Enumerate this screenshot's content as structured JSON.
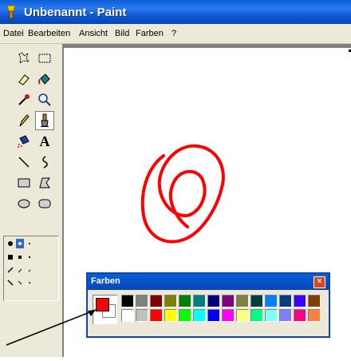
{
  "window": {
    "title": "Unbenannt - Paint"
  },
  "menu": [
    "Datei",
    "Bearbeiten",
    "Ansicht",
    "Bild",
    "Farben",
    "?"
  ],
  "tools": [
    {
      "name": "free-select-icon"
    },
    {
      "name": "rect-select-icon"
    },
    {
      "name": "eraser-icon"
    },
    {
      "name": "fill-bucket-icon"
    },
    {
      "name": "color-picker-icon"
    },
    {
      "name": "magnifier-icon"
    },
    {
      "name": "pencil-icon"
    },
    {
      "name": "brush-icon",
      "selected": true
    },
    {
      "name": "airbrush-icon"
    },
    {
      "name": "text-icon",
      "glyph": "A"
    },
    {
      "name": "line-icon"
    },
    {
      "name": "curve-icon"
    },
    {
      "name": "rectangle-icon"
    },
    {
      "name": "polygon-icon"
    },
    {
      "name": "ellipse-icon"
    },
    {
      "name": "rounded-rect-icon"
    }
  ],
  "palette": {
    "title": "Farben",
    "close_glyph": "×",
    "foreground": "#ff0000",
    "background": "#ffffff",
    "row1": [
      "#000000",
      "#808080",
      "#800000",
      "#808000",
      "#008000",
      "#008080",
      "#000080",
      "#800080",
      "#808040",
      "#004040",
      "#0080ff",
      "#004080",
      "#4000ff",
      "#804000"
    ],
    "row2": [
      "#ffffff",
      "#c0c0c0",
      "#ff0000",
      "#ffff00",
      "#00ff00",
      "#00ffff",
      "#0000ff",
      "#ff00ff",
      "#ffff80",
      "#00ff80",
      "#80ffff",
      "#8080ff",
      "#ff0080",
      "#ff8040"
    ]
  },
  "drawing": {
    "stroke_color": "#ff0000"
  }
}
